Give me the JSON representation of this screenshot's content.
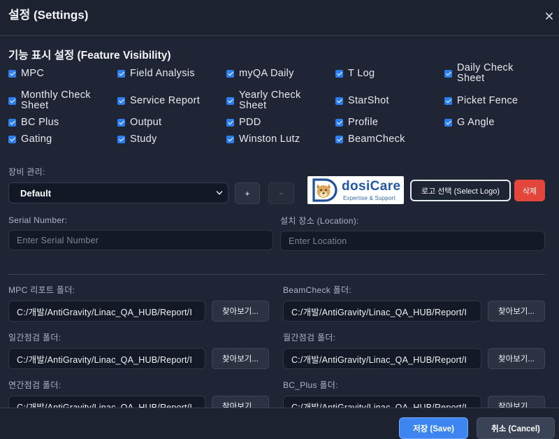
{
  "dialog": {
    "title": "설정 (Settings)"
  },
  "feature_visibility": {
    "heading": "기능 표시 설정 (Feature Visibility)",
    "items": [
      {
        "label": "MPC",
        "checked": true
      },
      {
        "label": "Field Analysis",
        "checked": true
      },
      {
        "label": "myQA Daily",
        "checked": true
      },
      {
        "label": "T Log",
        "checked": true
      },
      {
        "label": "Daily Check Sheet",
        "checked": true
      },
      {
        "label": "Monthly Check Sheet",
        "checked": true
      },
      {
        "label": "Service Report",
        "checked": true
      },
      {
        "label": "Yearly Check Sheet",
        "checked": true
      },
      {
        "label": "StarShot",
        "checked": true
      },
      {
        "label": "Picket Fence",
        "checked": true
      },
      {
        "label": "BC Plus",
        "checked": true
      },
      {
        "label": "Output",
        "checked": true
      },
      {
        "label": "PDD",
        "checked": true
      },
      {
        "label": "Profile",
        "checked": true
      },
      {
        "label": "G Angle",
        "checked": true
      },
      {
        "label": "Gating",
        "checked": true
      },
      {
        "label": "Study",
        "checked": true
      },
      {
        "label": "Winston Lutz",
        "checked": true
      },
      {
        "label": "BeamCheck",
        "checked": true
      }
    ]
  },
  "equipment": {
    "label": "장비 관리:",
    "selected": "Default",
    "add_label": "+",
    "remove_label": "−",
    "remove_disabled": true,
    "logo": {
      "brand": "dosiCare",
      "tagline": "Expertise & Support"
    },
    "select_logo_label": "로고 선택 (Select Logo)",
    "delete_label": "삭제"
  },
  "serial": {
    "label": "Serial Number:",
    "placeholder": "Enter Serial Number"
  },
  "location": {
    "label": "설치 장소 (Location):",
    "placeholder": "Enter Location"
  },
  "folders": [
    {
      "label": "MPC 리포트 폴더:",
      "value": "C:/개발/AntiGravity/Linac_QA_HUB/Report/I",
      "browse_label": "찾아보기..."
    },
    {
      "label": "BeamCheck 폴더:",
      "value": "C:/개발/AntiGravity/Linac_QA_HUB/Report/I",
      "browse_label": "찾아보기..."
    },
    {
      "label": "일간점검 폴더:",
      "value": "C:/개발/AntiGravity/Linac_QA_HUB/Report/I",
      "browse_label": "찾아보기..."
    },
    {
      "label": "월간점검 폴더:",
      "value": "C:/개발/AntiGravity/Linac_QA_HUB/Report/I",
      "browse_label": "찾아보기..."
    },
    {
      "label": "연간점검 폴더:",
      "value": "C:/개발/AntiGravity/Linac_QA_HUB/Report/I",
      "browse_label": "찾아보기..."
    },
    {
      "label": "BC_Plus 폴더:",
      "value": "C:/개발/AntiGravity/Linac_QA_HUB/Report/I",
      "browse_label": "찾아보기..."
    }
  ],
  "footer": {
    "save_label": "저장 (Save)",
    "cancel_label": "취소 (Cancel)"
  },
  "icons": {
    "close": "close-icon",
    "select": "chevron-down-icon",
    "logo": "dog-logo-icon"
  },
  "theme": {
    "background": "#1f2534",
    "accent": "#3d86f2",
    "checkbox": "#2d7ff0",
    "danger": "#e4463b"
  }
}
